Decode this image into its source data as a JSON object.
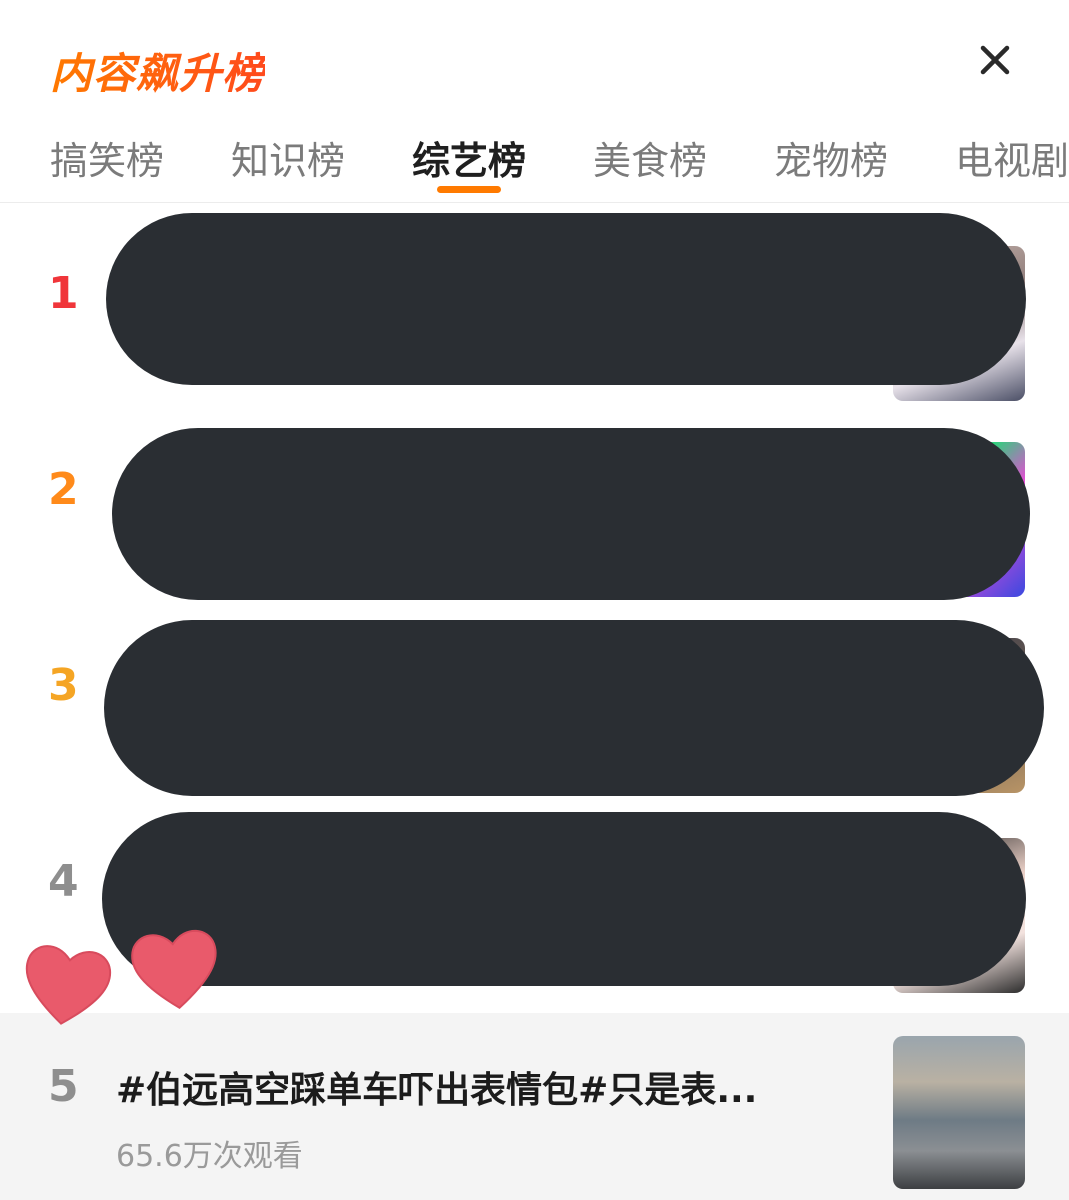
{
  "header": {
    "title": "内容飙升榜"
  },
  "tabs": [
    {
      "label": "搞笑榜"
    },
    {
      "label": "知识榜"
    },
    {
      "label": "综艺榜"
    },
    {
      "label": "美食榜"
    },
    {
      "label": "宠物榜"
    },
    {
      "label": "电视剧"
    }
  ],
  "active_tab": "综艺榜",
  "list": [
    {
      "rank": "1",
      "rank_color": "#f0353a"
    },
    {
      "rank": "2",
      "rank_color": "#ff8a1a"
    },
    {
      "rank": "3",
      "rank_color": "#f5a524"
    },
    {
      "rank": "4",
      "rank_color": "#8e8e8e"
    },
    {
      "rank": "5",
      "rank_color": "#8e8e8e",
      "title": "#伯远高空踩单车吓出表情包#只是表...",
      "views": "65.6万次观看"
    }
  ],
  "colors": {
    "accent": "#ff7a00",
    "redaction": "#2a2e33",
    "heart": "#e95a6b"
  }
}
